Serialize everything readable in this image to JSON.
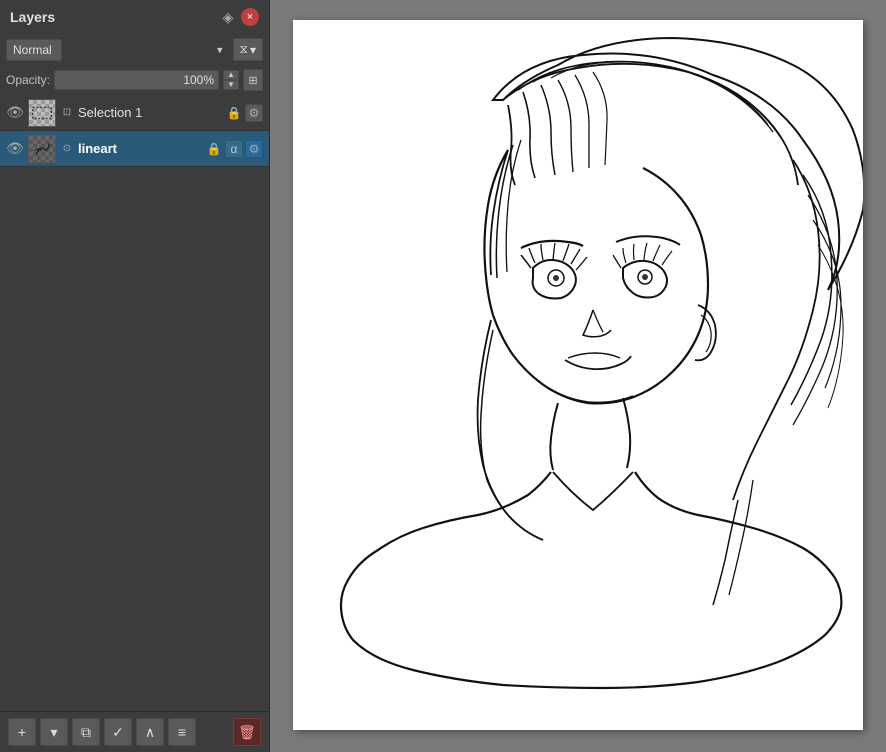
{
  "panel": {
    "title": "Layers",
    "blend_mode": "Normal",
    "opacity_label": "Opacity:",
    "opacity_value": "100%",
    "layers": [
      {
        "id": "layer-selection1",
        "name": "Selection 1",
        "visible": true,
        "active": false,
        "has_alpha": false,
        "type": "selection"
      },
      {
        "id": "layer-lineart",
        "name": "lineart",
        "visible": true,
        "active": true,
        "has_alpha": true,
        "type": "paint"
      }
    ]
  },
  "toolbar": {
    "add_label": "+",
    "duplicate_label": "⧉",
    "check_label": "✓",
    "up_label": "∧",
    "menu_label": "≡",
    "delete_label": "🗑"
  },
  "icons": {
    "close": "×",
    "pin": "◈",
    "eye": "👁",
    "lock": "🔒",
    "gear": "⚙",
    "alpha": "α",
    "filter": "⧖",
    "chevron_down": "▾",
    "copy": "📋"
  }
}
